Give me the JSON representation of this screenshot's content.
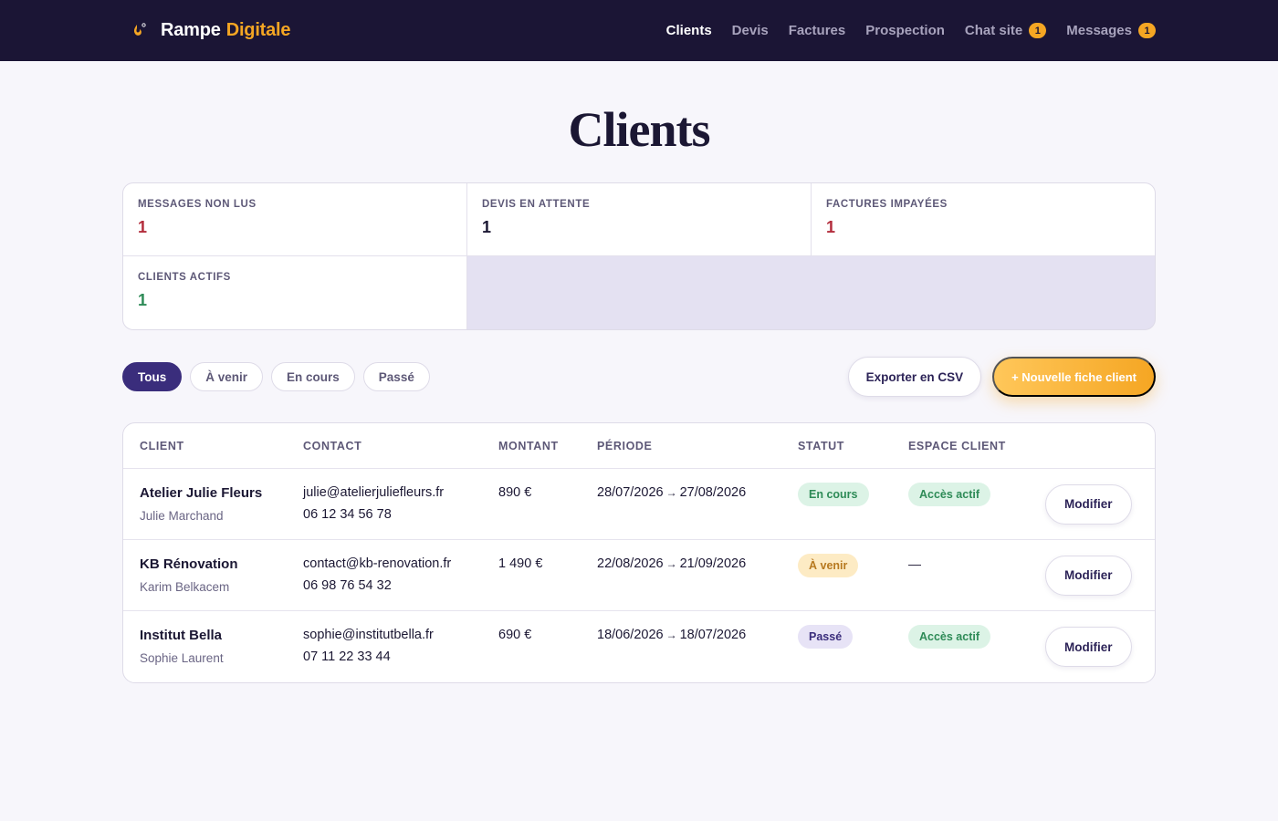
{
  "brand": {
    "name": "Rampe",
    "accent": "Digitale",
    "icon": "flame-icon"
  },
  "nav": [
    {
      "label": "Clients",
      "active": true,
      "badge": null
    },
    {
      "label": "Devis",
      "active": false,
      "badge": null
    },
    {
      "label": "Factures",
      "active": false,
      "badge": null
    },
    {
      "label": "Prospection",
      "active": false,
      "badge": null
    },
    {
      "label": "Chat site",
      "active": false,
      "badge": "1"
    },
    {
      "label": "Messages",
      "active": false,
      "badge": "1"
    }
  ],
  "page": {
    "title": "Clients"
  },
  "stats": [
    {
      "label": "Messages non lus",
      "value": "1",
      "color": "#b32d3c"
    },
    {
      "label": "Devis en attente",
      "value": "1",
      "color": "#1b1733"
    },
    {
      "label": "Factures impayées",
      "value": "1",
      "color": "#b32d3c"
    },
    {
      "label": "Clients actifs",
      "value": "1",
      "color": "#2e8b57"
    }
  ],
  "filters": [
    {
      "label": "Tous",
      "active": true
    },
    {
      "label": "À venir",
      "active": false
    },
    {
      "label": "En cours",
      "active": false
    },
    {
      "label": "Passé",
      "active": false
    }
  ],
  "actions": {
    "export_label": "Exporter en CSV",
    "new_label": "+ Nouvelle fiche client"
  },
  "table": {
    "headers": [
      "Client",
      "Contact",
      "Montant",
      "Période",
      "Statut",
      "Espace client"
    ],
    "edit_label": "Modifier",
    "arrow": "→",
    "rows": [
      {
        "name": "Atelier Julie Fleurs",
        "person": "Julie Marchand",
        "email": "julie@atelierjuliefleurs.fr",
        "phone": "06 12 34 56 78",
        "amount": "890 €",
        "start": "28/07/2026",
        "end": "27/08/2026",
        "status": "En cours",
        "status_kind": "green",
        "space": "Accès actif"
      },
      {
        "name": "KB Rénovation",
        "person": "Karim Belkacem",
        "email": "contact@kb-renovation.fr",
        "phone": "06 98 76 54 32",
        "amount": "1 490 €",
        "start": "22/08/2026",
        "end": "21/09/2026",
        "status": "À venir",
        "status_kind": "amber",
        "space": "—"
      },
      {
        "name": "Institut Bella",
        "person": "Sophie Laurent",
        "email": "sophie@institutbella.fr",
        "phone": "07 11 22 33 44",
        "amount": "690 €",
        "start": "18/06/2026",
        "end": "18/07/2026",
        "status": "Passé",
        "status_kind": "purple",
        "space": "Accès actif"
      }
    ]
  },
  "colors": {
    "nav_bg": "#1b1535",
    "accent": "#f5a623",
    "primary": "#3a2d7c"
  }
}
